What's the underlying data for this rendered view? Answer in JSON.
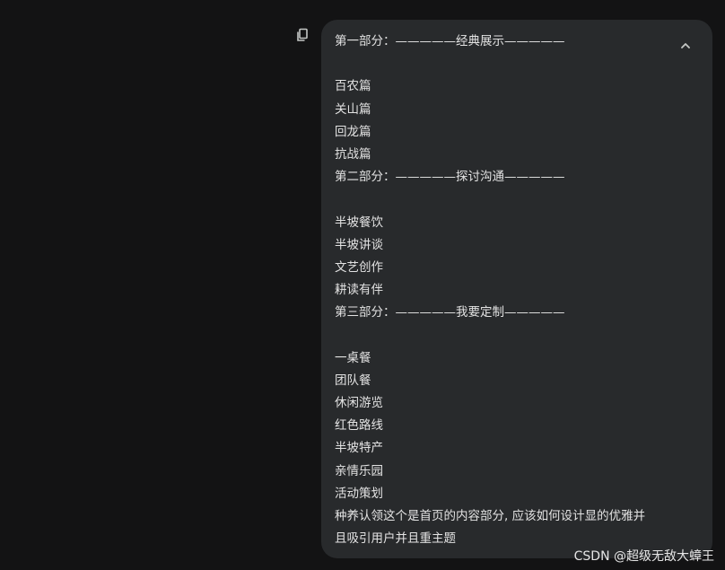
{
  "message": {
    "lines": [
      "第一部分：—————经典展示—————",
      "",
      "百农篇",
      "关山篇",
      "回龙篇",
      "抗战篇",
      "第二部分：—————探讨沟通—————",
      "",
      "半坡餐饮",
      "半坡讲谈",
      "文艺创作",
      "耕读有伴",
      "第三部分：—————我要定制—————",
      "",
      "一桌餐",
      "团队餐",
      "休闲游览",
      "红色路线",
      "半坡特产",
      "亲情乐园",
      "活动策划",
      "种养认领这个是首页的内容部分, 应该如何设计显的优雅并",
      "且吸引用户并且重主题"
    ],
    "copy_icon": "copy-icon",
    "collapse_icon": "chevron-up-icon"
  },
  "watermark": "CSDN @超级无敌大蟑王"
}
